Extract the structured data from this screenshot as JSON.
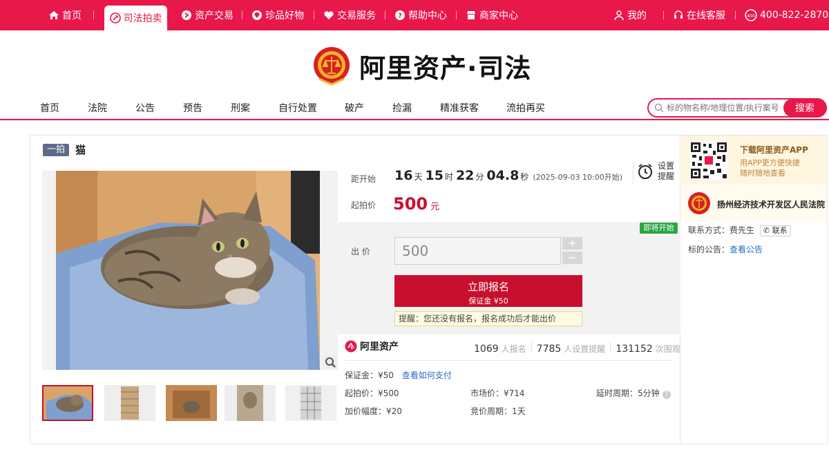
{
  "topbar": {
    "items": [
      "首页",
      "司法拍卖",
      "资产交易",
      "珍品好物",
      "交易服务",
      "帮助中心",
      "商家中心"
    ],
    "right": [
      "我的",
      "在线客服",
      "400-822-2870"
    ]
  },
  "logo": {
    "brand": "阿里资产·司法"
  },
  "nav": {
    "items": [
      "首页",
      "法院",
      "公告",
      "预告",
      "刑案",
      "自行处置",
      "破产",
      "捡漏",
      "精准获客",
      "流拍再买"
    ]
  },
  "search": {
    "placeholder": "标的物名称/地理位置/执行案号",
    "button": "搜索"
  },
  "item": {
    "badge": "一拍",
    "title": "猫",
    "countdown": {
      "label": "距开始",
      "days": "16",
      "days_unit": "天",
      "hours": "15",
      "hours_unit": "时",
      "minutes": "22",
      "minutes_unit": "分",
      "seconds": "04.8",
      "seconds_unit": "秒",
      "note": "(2025-09-03 10:00开始)"
    },
    "remind": "设置提醒",
    "start_price_label": "起拍价",
    "start_price": "500",
    "currency": "元",
    "soon_badge": "即将开始",
    "bid_label": "出 价",
    "bid_value": "500",
    "plus": "+",
    "minus": "−",
    "signup": "立即报名",
    "deposit_line": "保证金 ¥50",
    "tip": "提醒：您还没有报名，报名成功后才能出价"
  },
  "stats": {
    "brand": "阿里资产",
    "signups": "1069",
    "signups_unit": "人报名",
    "reminders": "7785",
    "reminders_unit": "人设置提醒",
    "views": "131152",
    "views_unit": "次围观"
  },
  "meta": {
    "deposit": "保证金：¥50",
    "how_to_pay": "查看如何支付",
    "start_price": "起拍价：¥500",
    "market_price": "市场价：¥714",
    "delay": "延时周期：5分钟",
    "increment": "加价幅度：¥20",
    "period": "竞价周期：1天"
  },
  "side": {
    "app_title": "下载阿里资产APP",
    "app_desc_1": "用APP更方便快捷",
    "app_desc_2": "随时随地查看",
    "court": "扬州经济技术开发区人民法院",
    "contact_label": "联系方式：",
    "contact_name": "费先生",
    "contact_btn": "联系",
    "notice_label": "标的公告：",
    "notice_link": "查看公告"
  },
  "colors": {
    "brand": "#e8184a",
    "price": "#c8102e",
    "soon": "#28a745",
    "link": "#2a6bc8"
  },
  "icons": [
    "home-icon",
    "gavel-icon",
    "asset-icon",
    "gem-icon",
    "heart-icon",
    "help-icon",
    "shop-icon",
    "user-icon",
    "headset-icon",
    "phone-icon",
    "search-icon",
    "alarm-icon",
    "zoom-icon",
    "qr-code-icon",
    "court-emblem-icon"
  ]
}
